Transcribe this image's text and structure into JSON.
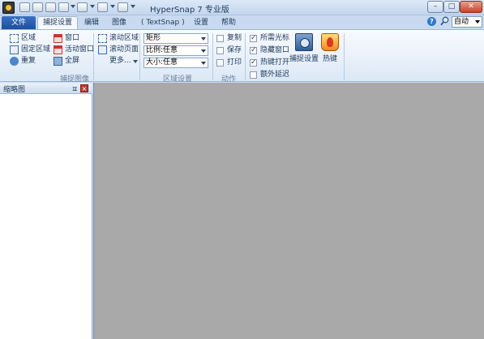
{
  "window": {
    "title": "HyperSnap 7 专业版",
    "minimize_glyph": "–",
    "maximize_glyph": "□",
    "close_glyph": "✕"
  },
  "ribbon_tabs": [
    "文件",
    "捕捉设置",
    "编辑",
    "图像",
    "( TextSnap )",
    "设置",
    "帮助"
  ],
  "toolbar_right": {
    "help_glyph": "?",
    "zoom_value": "自动"
  },
  "capture_group": {
    "col1": [
      "区域",
      "固定区域",
      "重复"
    ],
    "col2": [
      "窗口",
      "活动窗口",
      "全屏"
    ],
    "label": "捕捉图像"
  },
  "scroll_group": {
    "items": [
      "滚动区域",
      "滚动页面",
      "更多..."
    ]
  },
  "region_group": {
    "combos": [
      "矩形",
      "比例:任意",
      "大小:任意"
    ],
    "label": "区域设置"
  },
  "action_group": {
    "items": [
      {
        "label": "复制",
        "checked": false
      },
      {
        "label": "保存",
        "checked": false
      },
      {
        "label": "打印",
        "checked": false
      }
    ],
    "label": "动作"
  },
  "options_group": {
    "items": [
      {
        "label": "所需光标",
        "checked": true
      },
      {
        "label": "隐藏窗口",
        "checked": true
      },
      {
        "label": "热键打开",
        "checked": true
      },
      {
        "label": "额外延迟",
        "checked": false
      }
    ]
  },
  "big_buttons": {
    "capture_settings": "捕捉设置",
    "hotkeys": "热键"
  },
  "thumbnail_panel": {
    "title": "缩略图",
    "pin_glyph": "ㅍ",
    "close_glyph": "×"
  }
}
